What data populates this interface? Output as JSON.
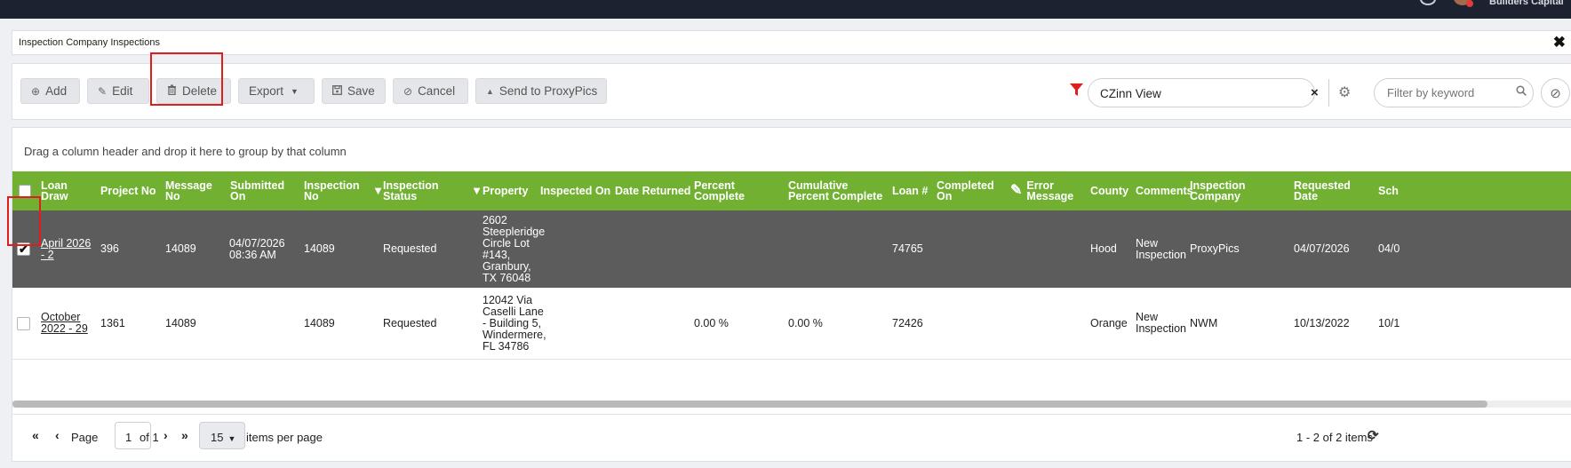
{
  "topbar": {
    "company": "Builders Capital"
  },
  "window": {
    "title": "Inspection Company Inspections"
  },
  "toolbar": {
    "add": "Add",
    "edit": "Edit",
    "delete": "Delete",
    "export": "Export",
    "save": "Save",
    "cancel": "Cancel",
    "send": "Send to ProxyPics"
  },
  "view": {
    "selected": "CZinn View"
  },
  "keyword": {
    "placeholder": "Filter by keyword"
  },
  "grid": {
    "group_hint": "Drag a column header and drop it here to group by that column",
    "columns": [
      "Loan Draw",
      "Project No",
      "Message No",
      "Submitted On",
      "Inspection No",
      "Inspection Status",
      "Property",
      "Inspected On",
      "Date Returned",
      "Percent Complete",
      "Cumulative Percent Complete",
      "Loan #",
      "Completed On",
      "Error Message",
      "County",
      "Comments",
      "Inspection Company",
      "Requested Date",
      "Sch"
    ],
    "rows": [
      {
        "loan_draw": "April 2026 - 2",
        "project_no": "396",
        "message_no": "14089",
        "submitted_on": "04/07/2026 08:36 AM",
        "inspection_no": "14089",
        "status": "Requested",
        "property": "2602 Steepleridge Circle Lot #143, Granbury, TX 76048",
        "inspected_on": "",
        "date_returned": "",
        "percent_complete": "",
        "cumulative_percent": "",
        "loan_num": "74765",
        "completed_on": "",
        "error_message": "",
        "county": "Hood",
        "comments": "New Inspection",
        "company": "ProxyPics",
        "requested_date": "04/07/2026",
        "sch": "04/0"
      },
      {
        "loan_draw": "October 2022 - 29",
        "project_no": "1361",
        "message_no": "14089",
        "submitted_on": "",
        "inspection_no": "14089",
        "status": "Requested",
        "property": "12042 Via Caselli Lane - Building 5, Windermere, FL 34786",
        "inspected_on": "",
        "date_returned": "",
        "percent_complete": "0.00 %",
        "cumulative_percent": "0.00 %",
        "loan_num": "72426",
        "completed_on": "",
        "error_message": "",
        "county": "Orange",
        "comments": "New Inspection",
        "company": "NWM",
        "requested_date": "10/13/2022",
        "sch": "10/1"
      }
    ]
  },
  "pager": {
    "page_label": "Page",
    "page_value": "1",
    "of_label": "of 1",
    "per_page_value": "15",
    "per_page_label": "items per page",
    "summary": "1 - 2 of 2 items"
  },
  "colors": {
    "header_green": "#72b032",
    "selected_row": "#5c5c5c",
    "highlight_red": "#e01e1e"
  }
}
